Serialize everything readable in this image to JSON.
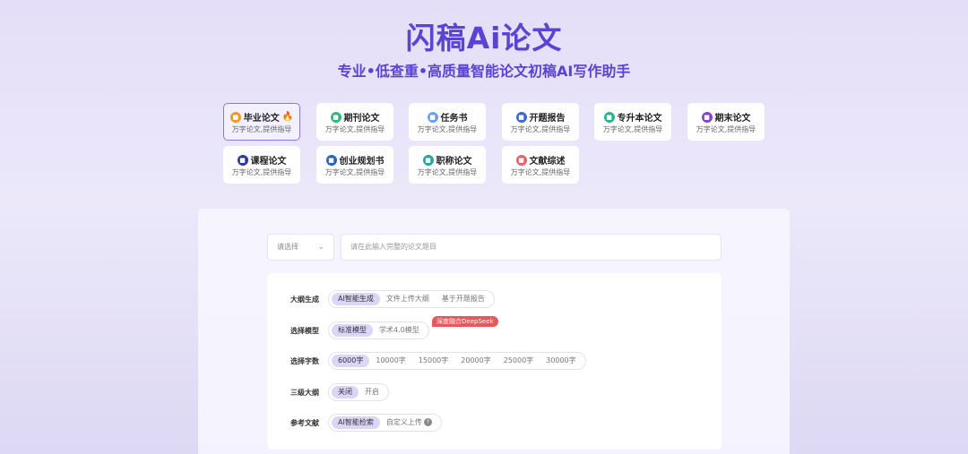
{
  "hero": {
    "title": "闪稿Ai论文",
    "subtitle": "专业•低查重•高质量智能论文初稿AI写作助手"
  },
  "categories": [
    {
      "label": "毕业论文",
      "desc": "万字论文,提供指导",
      "icon_color": "#f29a1d",
      "icon": "doc-icon",
      "hot": true,
      "active": true
    },
    {
      "label": "期刊论文",
      "desc": "万字论文,提供指导",
      "icon_color": "#2fb87a",
      "icon": "journal-icon"
    },
    {
      "label": "任务书",
      "desc": "万字论文,提供指导",
      "icon_color": "#6aa0f0",
      "icon": "task-icon"
    },
    {
      "label": "开题报告",
      "desc": "万字论文,提供指导",
      "icon_color": "#3b68c9",
      "icon": "report-icon"
    },
    {
      "label": "专升本论文",
      "desc": "万字论文,提供指导",
      "icon_color": "#27b48b",
      "icon": "upgrade-icon"
    },
    {
      "label": "期末论文",
      "desc": "万字论文,提供指导",
      "icon_color": "#8a3fd1",
      "icon": "final-icon"
    },
    {
      "label": "课程论文",
      "desc": "万字论文,提供指导",
      "icon_color": "#2a3a9c",
      "icon": "course-icon"
    },
    {
      "label": "创业规划书",
      "desc": "万字论文,提供指导",
      "icon_color": "#2b62b8",
      "icon": "plan-icon"
    },
    {
      "label": "职称论文",
      "desc": "万字论文,提供指导",
      "icon_color": "#2aa39a",
      "icon": "title-icon"
    },
    {
      "label": "文献综述",
      "desc": "万字论文,提供指导",
      "icon_color": "#e0646a",
      "icon": "literature-icon"
    }
  ],
  "form": {
    "select_placeholder": "请选择",
    "title_placeholder": "请在此输入完整的论文题目",
    "badge": "深度融合DeepSeek",
    "rows": [
      {
        "label": "大纲生成",
        "options": [
          "AI智能生成",
          "文件上传大纲",
          "基于开题报告"
        ],
        "selected": 0
      },
      {
        "label": "选择模型",
        "options": [
          "标准模型",
          "学术4.0模型"
        ],
        "selected": 0
      },
      {
        "label": "选择字数",
        "options": [
          "6000字",
          "10000字",
          "15000字",
          "20000字",
          "25000字",
          "30000字"
        ],
        "selected": 0
      },
      {
        "label": "三级大纲",
        "options": [
          "关闭",
          "开启"
        ],
        "selected": 0
      },
      {
        "label": "参考文献",
        "options": [
          "AI智能检索",
          "自定义上传"
        ],
        "selected": 0
      }
    ]
  },
  "colors": {
    "accent": "#5b43d6",
    "selected_bg": "#dcd5f7",
    "hot": "#f04a3a"
  }
}
